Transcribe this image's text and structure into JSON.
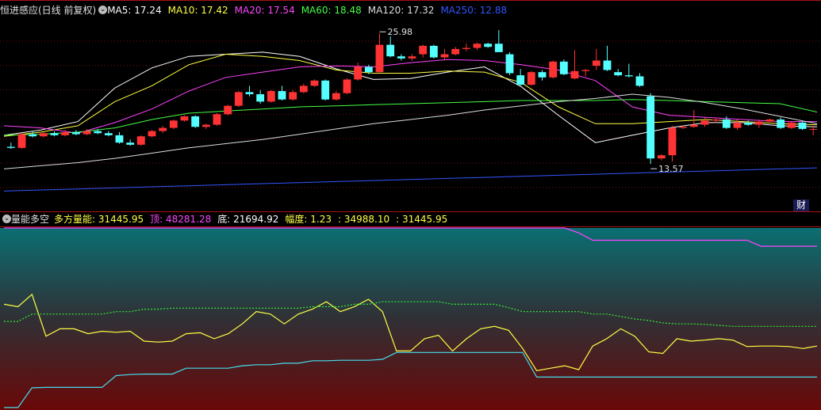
{
  "top_header": {
    "title": "恒进感应(日线 前复权)",
    "ma": [
      {
        "label": "MA5: 17.24",
        "color": "#ffffff"
      },
      {
        "label": "MA10: 17.42",
        "color": "#ffff44"
      },
      {
        "label": "MA20: 17.54",
        "color": "#ff44ff"
      },
      {
        "label": "MA60: 18.48",
        "color": "#44ff44"
      },
      {
        "label": "MA120: 17.32",
        "color": "#dddddd"
      },
      {
        "label": "MA250: 12.88",
        "color": "#3355ff"
      }
    ]
  },
  "bottom_header": {
    "title": "量能多空",
    "items": [
      {
        "label": "多方量能: 31445.95",
        "color": "#ffff44"
      },
      {
        "label": "顶: 48281.28",
        "color": "#ff44ff"
      },
      {
        "label": "底: 21694.92",
        "color": "#ffffff"
      },
      {
        "label": "幅度: 1.23",
        "color": "#ffff44"
      },
      {
        "label": ": 34988.10",
        "color": "#ffff44"
      },
      {
        "label": ": 31445.95",
        "color": "#ffff44"
      }
    ]
  },
  "badge": "财",
  "annotations": {
    "high": "25.98",
    "low": "13.57"
  },
  "colors": {
    "up": "#ff3333",
    "down": "#54ffff",
    "bg": "#000000"
  },
  "chart_data": [
    {
      "type": "candlestick",
      "ylim": [
        10.5,
        27.5
      ],
      "candles": [
        [
          15.2,
          15.6,
          15.0,
          15.1
        ],
        [
          15.1,
          16.5,
          15.0,
          16.4
        ],
        [
          16.4,
          16.7,
          16.1,
          16.2
        ],
        [
          16.2,
          16.6,
          16.1,
          16.5
        ],
        [
          16.5,
          16.7,
          16.2,
          16.3
        ],
        [
          16.3,
          16.8,
          16.2,
          16.6
        ],
        [
          16.6,
          16.8,
          16.3,
          16.4
        ],
        [
          16.4,
          16.9,
          16.3,
          16.7
        ],
        [
          16.7,
          16.9,
          16.4,
          16.5
        ],
        [
          16.5,
          16.7,
          16.2,
          16.3
        ],
        [
          16.3,
          16.6,
          15.5,
          15.6
        ],
        [
          15.6,
          15.9,
          15.3,
          15.4
        ],
        [
          15.4,
          16.3,
          15.3,
          16.2
        ],
        [
          16.2,
          16.8,
          16.1,
          16.7
        ],
        [
          16.7,
          17.2,
          16.5,
          17.0
        ],
        [
          17.0,
          17.8,
          16.9,
          17.7
        ],
        [
          17.7,
          18.2,
          17.6,
          18.1
        ],
        [
          18.1,
          18.2,
          17.0,
          17.1
        ],
        [
          17.1,
          17.4,
          16.9,
          17.3
        ],
        [
          17.3,
          18.4,
          17.2,
          18.3
        ],
        [
          18.3,
          19.2,
          18.2,
          19.1
        ],
        [
          19.1,
          20.5,
          19.0,
          20.4
        ],
        [
          20.4,
          21.0,
          20.0,
          20.2
        ],
        [
          20.2,
          20.6,
          19.3,
          19.5
        ],
        [
          19.5,
          20.6,
          19.4,
          20.5
        ],
        [
          20.5,
          21.0,
          19.6,
          19.7
        ],
        [
          19.7,
          20.6,
          19.6,
          20.4
        ],
        [
          20.4,
          21.2,
          20.3,
          21.0
        ],
        [
          21.0,
          21.6,
          20.9,
          21.5
        ],
        [
          21.5,
          21.6,
          19.6,
          19.7
        ],
        [
          19.7,
          20.5,
          19.6,
          20.3
        ],
        [
          20.3,
          21.7,
          20.2,
          21.6
        ],
        [
          21.6,
          23.2,
          21.5,
          22.8
        ],
        [
          22.8,
          23.0,
          22.1,
          22.3
        ],
        [
          22.3,
          25.98,
          22.2,
          24.9
        ],
        [
          24.9,
          25.7,
          23.7,
          23.8
        ],
        [
          23.8,
          24.0,
          23.4,
          23.6
        ],
        [
          23.6,
          24.0,
          23.4,
          23.8
        ],
        [
          24.0,
          24.9,
          23.7,
          24.8
        ],
        [
          24.8,
          24.9,
          23.6,
          23.7
        ],
        [
          23.7,
          24.5,
          23.4,
          24.0
        ],
        [
          24.0,
          24.7,
          23.9,
          24.5
        ],
        [
          24.5,
          25.0,
          24.3,
          24.6
        ],
        [
          24.6,
          25.1,
          24.4,
          25.0
        ],
        [
          25.0,
          25.1,
          24.6,
          24.7
        ],
        [
          25.0,
          26.3,
          24.4,
          24.2
        ],
        [
          24.0,
          24.2,
          22.0,
          22.2
        ],
        [
          22.0,
          22.6,
          21.0,
          21.1
        ],
        [
          21.1,
          22.4,
          21.0,
          22.3
        ],
        [
          22.3,
          22.5,
          21.5,
          21.8
        ],
        [
          21.8,
          23.4,
          21.7,
          23.3
        ],
        [
          23.3,
          23.5,
          22.0,
          22.1
        ],
        [
          21.7,
          24.4,
          21.6,
          22.4
        ],
        [
          22.4,
          22.6,
          21.9,
          22.5
        ],
        [
          22.9,
          24.5,
          22.5,
          23.4
        ],
        [
          23.4,
          24.8,
          22.4,
          22.5
        ],
        [
          22.3,
          22.6,
          21.9,
          22.0
        ],
        [
          22.0,
          23.1,
          21.8,
          21.9
        ],
        [
          21.9,
          22.2,
          20.9,
          21.0
        ],
        [
          20.0,
          20.3,
          13.57,
          14.1
        ],
        [
          14.1,
          14.5,
          13.9,
          14.4
        ],
        [
          14.4,
          17.2,
          13.8,
          17.0
        ],
        [
          17.0,
          17.2,
          16.9,
          17.1
        ],
        [
          17.1,
          18.7,
          17.0,
          17.3
        ],
        [
          17.3,
          18.0,
          17.1,
          17.7
        ],
        [
          17.7,
          17.9,
          17.5,
          17.8
        ],
        [
          17.8,
          18.1,
          16.9,
          17.0
        ],
        [
          17.0,
          17.8,
          16.8,
          17.5
        ],
        [
          17.5,
          17.7,
          17.2,
          17.3
        ],
        [
          17.3,
          17.8,
          17.0,
          17.6
        ],
        [
          17.6,
          17.9,
          17.4,
          17.8
        ],
        [
          17.8,
          18.0,
          16.9,
          17.0
        ],
        [
          17.0,
          17.6,
          16.9,
          17.5
        ],
        [
          17.5,
          17.6,
          16.8,
          16.9
        ],
        [
          16.9,
          17.2,
          16.3,
          16.9
        ]
      ],
      "ma_series": [
        {
          "name": "MA5",
          "color": "#ffffff",
          "values": [
            16.3,
            16.8,
            17.6,
            20.8,
            22.7,
            23.8,
            24.0,
            24.2,
            23.8,
            22.6,
            21.6,
            21.7,
            22.3,
            22.8,
            20.9,
            18.2,
            15.6,
            16.3,
            17.0,
            17.5,
            17.5,
            17.2,
            17.1
          ]
        },
        {
          "name": "MA10",
          "color": "#ffff44",
          "values": [
            16.2,
            16.6,
            17.2,
            19.5,
            21.0,
            23.0,
            24.0,
            23.8,
            23.4,
            22.5,
            22.2,
            22.2,
            22.4,
            22.3,
            21.3,
            19.0,
            17.4,
            17.4,
            17.6,
            17.8,
            17.6,
            17.4,
            17.3
          ]
        },
        {
          "name": "MA20",
          "color": "#ff44ff",
          "values": [
            17.2,
            17.0,
            16.5,
            17.5,
            18.8,
            20.5,
            21.8,
            22.3,
            22.8,
            22.9,
            22.8,
            23.2,
            23.5,
            23.4,
            23.0,
            22.5,
            21.5,
            19.0,
            18.2,
            18.0,
            17.8,
            17.6,
            17.6
          ]
        },
        {
          "name": "MA60",
          "color": "#44ff44",
          "values": [
            16.3,
            16.4,
            16.6,
            17.0,
            17.8,
            18.4,
            18.6,
            18.8,
            19.0,
            19.1,
            19.2,
            19.3,
            19.4,
            19.5,
            19.6,
            19.6,
            19.6,
            19.7,
            19.6,
            19.5,
            19.4,
            19.3,
            18.5
          ]
        },
        {
          "name": "MA120",
          "color": "#dddddd",
          "values": [
            13.1,
            13.4,
            13.7,
            14.1,
            14.6,
            15.1,
            15.5,
            15.9,
            16.4,
            16.9,
            17.4,
            17.8,
            18.2,
            18.7,
            19.1,
            19.5,
            19.8,
            20.2,
            19.9,
            19.4,
            18.8,
            18.1,
            17.4
          ]
        },
        {
          "name": "MA250",
          "color": "#3355ff",
          "values": [
            11.0,
            11.1,
            11.2,
            11.3,
            11.4,
            11.5,
            11.6,
            11.7,
            11.8,
            11.9,
            12.0,
            12.1,
            12.2,
            12.3,
            12.4,
            12.5,
            12.6,
            12.7,
            12.8,
            12.9,
            13.0,
            13.1,
            13.2
          ]
        }
      ]
    },
    {
      "type": "line",
      "ylim": [
        15000,
        52000
      ],
      "series": [
        {
          "name": "多方量能",
          "color": "#ffff44",
          "dash": false,
          "values": [
            36500,
            36000,
            38500,
            30000,
            31500,
            31500,
            30500,
            31000,
            30800,
            31000,
            29000,
            28800,
            29000,
            30500,
            30700,
            29500,
            30500,
            32500,
            35000,
            34500,
            32500,
            34500,
            35500,
            37000,
            35000,
            36000,
            37500,
            35000,
            27000,
            27000,
            29500,
            30200,
            27000,
            29500,
            31500,
            32000,
            31200,
            27500,
            23000,
            23500,
            24000,
            23200,
            28000,
            29500,
            31500,
            30000,
            26800,
            26500,
            29500,
            29000,
            29200,
            29500,
            29200,
            27900,
            28000,
            28000,
            27900,
            27500,
            28000
          ]
        },
        {
          "name": "顶",
          "color": "#ff44ff",
          "dash": false,
          "values": [
            55000,
            55000,
            55000,
            55000,
            55000,
            55000,
            55000,
            55000,
            55000,
            55000,
            55000,
            55000,
            55000,
            55000,
            55000,
            55000,
            55000,
            55000,
            55000,
            55000,
            55000,
            55000,
            55000,
            55000,
            55000,
            55000,
            55000,
            55000,
            55000,
            55000,
            55000,
            55000,
            55000,
            55000,
            55000,
            55000,
            55000,
            55000,
            55000,
            55000,
            54000,
            51000,
            49500,
            49500,
            49500,
            49500,
            49500,
            49500,
            49500,
            49500,
            49500,
            49500,
            49500,
            49500,
            48281,
            48281,
            48281,
            48281,
            48281
          ]
        },
        {
          "name": "dotted",
          "color": "#33ee33",
          "dash": true,
          "values": [
            33000,
            33000,
            34500,
            34500,
            34500,
            34500,
            34500,
            34500,
            35000,
            35000,
            35500,
            35500,
            35700,
            35700,
            35700,
            35700,
            35700,
            35700,
            35700,
            35700,
            35700,
            35700,
            36000,
            36000,
            36000,
            36500,
            36500,
            37000,
            37000,
            37000,
            37000,
            37000,
            36500,
            36500,
            36500,
            36500,
            35800,
            35000,
            35000,
            35000,
            35000,
            35000,
            34500,
            34500,
            34000,
            33500,
            33200,
            32700,
            32500,
            32500,
            32400,
            32200,
            32000,
            32000,
            32000,
            32000,
            32000,
            32000,
            32000
          ]
        },
        {
          "name": "底",
          "color": "#44ddee",
          "dash": false,
          "values": [
            15500,
            15500,
            19500,
            19600,
            19600,
            19600,
            19600,
            19600,
            22000,
            22200,
            22300,
            22300,
            22300,
            23500,
            23500,
            23500,
            23500,
            24000,
            24200,
            24200,
            24500,
            24500,
            25000,
            25000,
            25100,
            25100,
            25100,
            25300,
            26700,
            26700,
            26700,
            26700,
            26700,
            26700,
            26700,
            26700,
            26700,
            26700,
            21694,
            21694,
            21694,
            21694,
            21694,
            21694,
            21694,
            21694,
            21694,
            21694,
            21694,
            21694,
            21694,
            21694,
            21694,
            21694,
            21694,
            21694,
            21694,
            21694,
            21694
          ]
        }
      ]
    }
  ]
}
